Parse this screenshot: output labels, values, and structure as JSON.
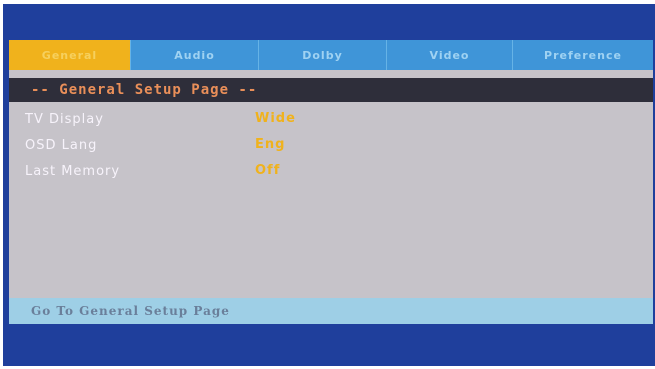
{
  "tabs": [
    {
      "label": "General",
      "active": true
    },
    {
      "label": "Audio",
      "active": false
    },
    {
      "label": "Dolby",
      "active": false
    },
    {
      "label": "Video",
      "active": false
    },
    {
      "label": "Preference",
      "active": false
    }
  ],
  "page": {
    "title": "-- General Setup Page --"
  },
  "settings": [
    {
      "label": "TV Display",
      "value": "Wide"
    },
    {
      "label": "OSD Lang",
      "value": "Eng"
    },
    {
      "label": "Last Memory",
      "value": "Off"
    }
  ],
  "status_bar": {
    "text": "Go To General Setup Page"
  },
  "colors": {
    "screen_bg": "#1f3f9c",
    "tab_bar": "#3f95d8",
    "tab_active": "#f0b21c",
    "panel_bg": "#c6c3c9",
    "header_bg": "#2e2e3a",
    "title_text": "#e98f59",
    "value_text": "#f0b21c",
    "status_bg": "#9ecfe6"
  }
}
